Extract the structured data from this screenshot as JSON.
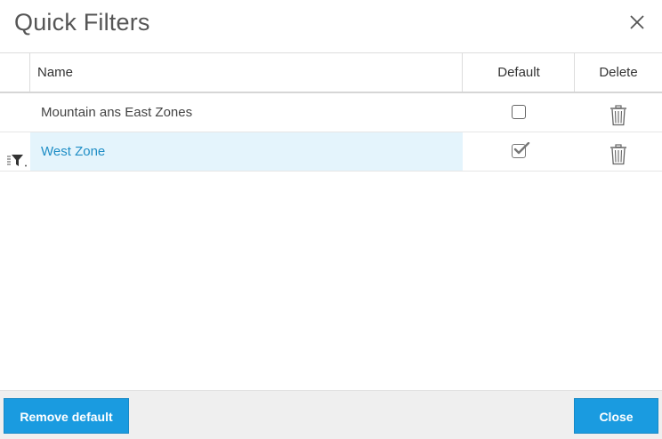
{
  "dialog": {
    "title": "Quick Filters",
    "close_icon": "close-icon"
  },
  "table": {
    "columns": {
      "name": "Name",
      "default": "Default",
      "delete": "Delete"
    },
    "rows": [
      {
        "name": "Mountain ans East Zones",
        "is_default": false,
        "selected": false,
        "active_filter": false
      },
      {
        "name": "West Zone",
        "is_default": true,
        "selected": true,
        "active_filter": true
      }
    ]
  },
  "footer": {
    "remove_default_label": "Remove default",
    "close_label": "Close"
  },
  "colors": {
    "accent": "#1a9be0",
    "selected_row_bg": "#e4f4fc",
    "selected_text": "#1f8ec6"
  }
}
